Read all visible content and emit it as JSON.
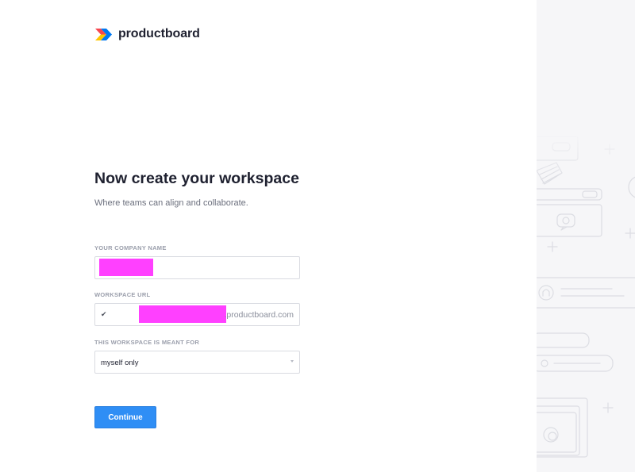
{
  "brand": {
    "name": "productboard",
    "colors": {
      "red": "#f6474f",
      "yellow": "#ffc600",
      "blue": "#0079f2"
    }
  },
  "heading": {
    "title": "Now create your workspace",
    "subtitle": "Where teams can align and collaborate."
  },
  "form": {
    "company_name": {
      "label": "YOUR COMPANY NAME",
      "value": ""
    },
    "workspace_url": {
      "label": "WORKSPACE URL",
      "status_icon": "✔",
      "value": "",
      "suffix": ".productboard.com"
    },
    "meant_for": {
      "label": "THIS WORKSPACE IS MEANT FOR",
      "selected": "myself only"
    },
    "continue_label": "Continue"
  },
  "colors": {
    "accent": "#2f8ef5",
    "redaction": "#ff40ff"
  }
}
